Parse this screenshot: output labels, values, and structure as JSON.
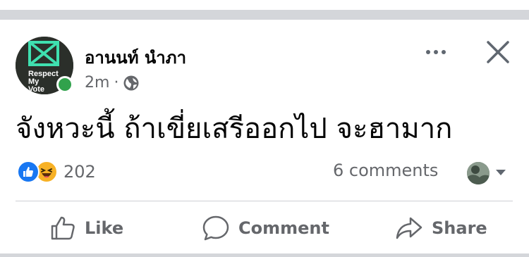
{
  "post": {
    "author": "อานนท์ นำภา",
    "time": "2m",
    "separator": "·",
    "privacy_icon": "globe-icon",
    "avatar_text": "Respect My Vote",
    "text": "จังหวะนี้ ถ้าเขี่ยเสรีออกไป จะฮามาก"
  },
  "stats": {
    "reaction_icons": [
      "like-icon",
      "haha-icon"
    ],
    "reaction_count": "202",
    "comment_count": "6 comments"
  },
  "actions": {
    "like": "Like",
    "comment": "Comment",
    "share": "Share"
  },
  "colors": {
    "accent_blue": "#1877f2",
    "online_green": "#31a24c",
    "haha_yellow": "#f7b125",
    "secondary_text": "#65676b",
    "separator_gray": "#d4d6da"
  }
}
